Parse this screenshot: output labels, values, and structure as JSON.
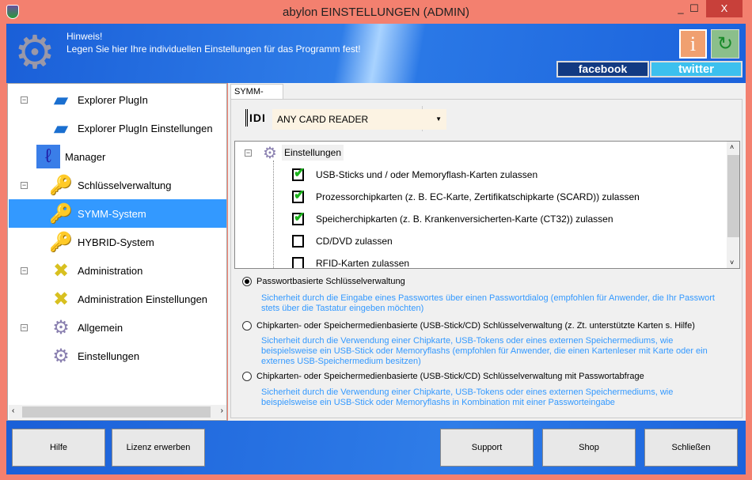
{
  "window": {
    "title": "abylon EINSTELLUNGEN (ADMIN)",
    "minimize": "_",
    "maximize": "☐",
    "close": "X"
  },
  "header": {
    "hint_title": "Hinweis!",
    "hint_text": "Legen Sie hier Ihre individuellen Einstellungen für das Programm fest!",
    "info_icon": "i",
    "facebook": "facebook",
    "twitter": "twitter"
  },
  "sidebar": {
    "items": [
      {
        "label": "Explorer PlugIn",
        "icon": "explorer-plugin-icon"
      },
      {
        "label": "Explorer PlugIn Einstellungen",
        "icon": "explorer-plugin-icon"
      },
      {
        "label": "Manager",
        "icon": "manager-icon"
      },
      {
        "label": "Schlüsselverwaltung",
        "icon": "key-icon"
      },
      {
        "label": "SYMM-System",
        "icon": "key-icon",
        "selected": true
      },
      {
        "label": "HYBRID-System",
        "icon": "key-icon"
      },
      {
        "label": "Administration",
        "icon": "tools-icon"
      },
      {
        "label": "Administration Einstellungen",
        "icon": "tools-icon"
      },
      {
        "label": "Allgemein",
        "icon": "gear-icon"
      },
      {
        "label": "Einstellungen",
        "icon": "gear-icon"
      }
    ],
    "collapse": "−"
  },
  "main": {
    "tab": "SYMM-System",
    "id_icon": "IDI",
    "reader": {
      "value": "ANY CARD READER",
      "arrow": "▼"
    },
    "tree": {
      "root": "Einstellungen",
      "items": [
        {
          "label": "USB-Sticks und / oder Memoryflash-Karten zulassen",
          "checked": true
        },
        {
          "label": "Prozessorchipkarten (z. B. EC-Karte, Zertifikatschipkarte (SCARD)) zulassen",
          "checked": true
        },
        {
          "label": "Speicherchipkarten (z. B. Krankenversicherten-Karte (CT32)) zulassen",
          "checked": true
        },
        {
          "label": "CD/DVD zulassen",
          "checked": false
        },
        {
          "label": "RFID-Karten zulassen",
          "checked": false
        }
      ]
    },
    "options": [
      {
        "label": "Passwortbasierte Schlüsselverwaltung",
        "selected": true,
        "desc": "Sicherheit durch die Eingabe eines Passwortes über einen Passwortdialog (empfohlen für Anwender, die Ihr Passwort stets über die Tastatur eingeben möchten)"
      },
      {
        "label": "Chipkarten- oder Speichermedienbasierte (USB-Stick/CD) Schlüsselverwaltung (z. Zt. unterstützte Karten s. Hilfe)",
        "selected": false,
        "desc": "Sicherheit durch die Verwendung einer Chipkarte, USB-Tokens oder eines externen Speichermediums, wie beispielsweise ein USB-Stick oder Memoryflashs (empfohlen für Anwender, die einen Kartenleser mit Karte oder ein externes USB-Speichermedium besitzen)"
      },
      {
        "label": "Chipkarten- oder Speichermedienbasierte (USB-Stick/CD) Schlüsselverwaltung mit Passwortabfrage",
        "selected": false,
        "desc": "Sicherheit durch die Verwendung einer Chipkarte, USB-Tokens oder eines externen Speichermediums, wie beispielsweise ein USB-Stick oder Memoryflashs in Kombination mit einer Passworteingabe"
      }
    ]
  },
  "footer": {
    "help": "Hilfe",
    "license": "Lizenz erwerben",
    "support": "Support",
    "shop": "Shop",
    "close": "Schließen"
  },
  "colors": {
    "titlebar": "#f3806f",
    "header": "#1f6ae0",
    "selection": "#3399ff",
    "description": "#3399ff",
    "check": "#1cb31c"
  }
}
